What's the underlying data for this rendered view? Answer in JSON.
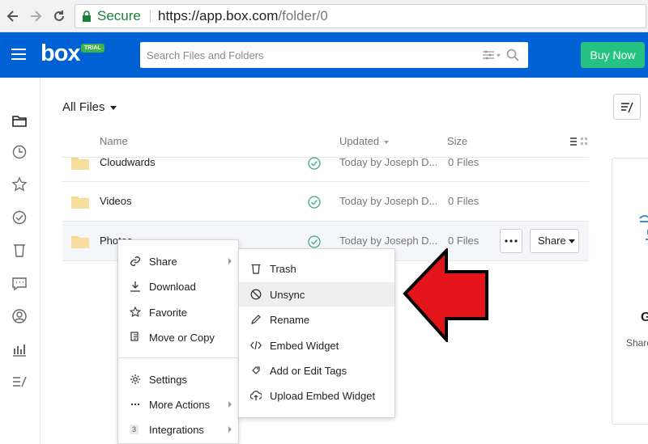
{
  "browser": {
    "secure_label": "Secure",
    "url_host": "https://app.box.com",
    "url_path": "/folder/0"
  },
  "header": {
    "logo": "box",
    "trial_badge": "TRIAL",
    "search_placeholder": "Search Files and Folders",
    "buy_now": "Buy Now",
    "brand_color": "#0061d5",
    "buy_color": "#26c281"
  },
  "main": {
    "breadcrumb": "All Files",
    "columns": {
      "name": "Name",
      "updated": "Updated",
      "size": "Size"
    },
    "rows": [
      {
        "name": "Cloudwards",
        "updated": "Today by Joseph D...",
        "size": "0 Files"
      },
      {
        "name": "Videos",
        "updated": "Today by Joseph D...",
        "size": "0 Files"
      },
      {
        "name": "Photos",
        "updated": "Today by Joseph D...",
        "size": "0 Files"
      }
    ],
    "share_button": "Share",
    "right_panel": {
      "heading": "G",
      "text": "Share"
    }
  },
  "context_menu": {
    "items": [
      {
        "label": "Share",
        "icon": "link-icon",
        "submenu": true
      },
      {
        "label": "Download",
        "icon": "download-icon"
      },
      {
        "label": "Favorite",
        "icon": "star-icon"
      },
      {
        "label": "Move or Copy",
        "icon": "copy-icon"
      },
      {
        "label": "Settings",
        "icon": "gear-icon"
      },
      {
        "label": "More Actions",
        "icon": "ellipsis-icon",
        "submenu": true
      },
      {
        "label": "Integrations",
        "icon": "integrations-icon",
        "badge": "3",
        "submenu": true
      }
    ]
  },
  "submenu": {
    "items": [
      {
        "label": "Trash",
        "icon": "trash-icon"
      },
      {
        "label": "Unsync",
        "icon": "unsync-icon",
        "active": true
      },
      {
        "label": "Rename",
        "icon": "pencil-icon"
      },
      {
        "label": "Embed Widget",
        "icon": "code-icon"
      },
      {
        "label": "Add or Edit Tags",
        "icon": "tag-icon"
      },
      {
        "label": "Upload Embed Widget",
        "icon": "cloud-upload-icon"
      }
    ]
  },
  "annotation": {
    "arrow_color": "#e3151a"
  }
}
